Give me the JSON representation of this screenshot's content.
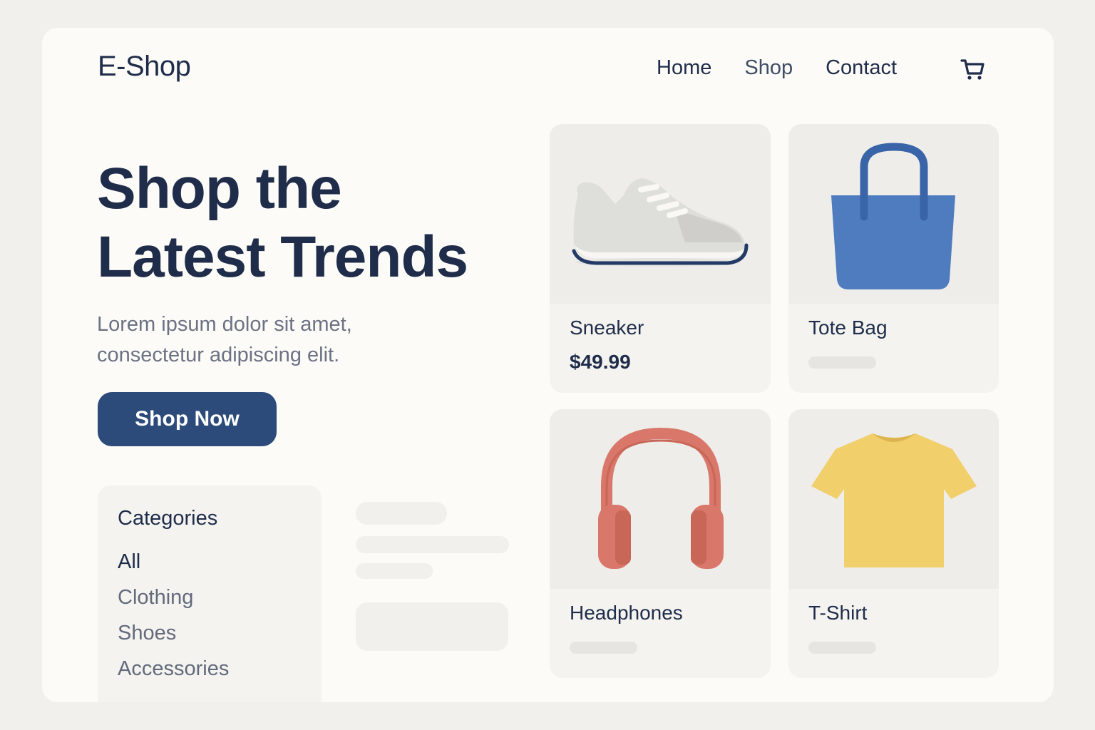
{
  "header": {
    "logo": "E-Shop",
    "nav": [
      {
        "label": "Home"
      },
      {
        "label": "Shop"
      },
      {
        "label": "Contact"
      }
    ],
    "cart_icon": "shopping-cart-icon"
  },
  "hero": {
    "title_line1": "Shop the",
    "title_line2": "Latest Trends",
    "subtitle_line1": "Lorem ipsum  dolor sit amet,",
    "subtitle_line2": "consectetur adipiscing elit.",
    "cta_label": "Shop Now"
  },
  "categories": {
    "title": "Categories",
    "items": [
      {
        "label": "All"
      },
      {
        "label": "Clothing"
      },
      {
        "label": "Shoes"
      },
      {
        "label": "Accessories"
      }
    ]
  },
  "products": [
    {
      "name": "Sneaker",
      "price": "$49.99",
      "icon": "sneaker-icon"
    },
    {
      "name": "Tote Bag",
      "icon": "tote-bag-icon",
      "color": "#4f7cbf"
    },
    {
      "name": "Headphones",
      "icon": "headphones-icon",
      "color": "#d9786a"
    },
    {
      "name": "T-Shirt",
      "icon": "t-shirt-icon",
      "color": "#f1cf6b"
    }
  ],
  "colors": {
    "brand": "#2c4a7a",
    "text": "#1f2d4b",
    "background": "#fcfbf7"
  }
}
